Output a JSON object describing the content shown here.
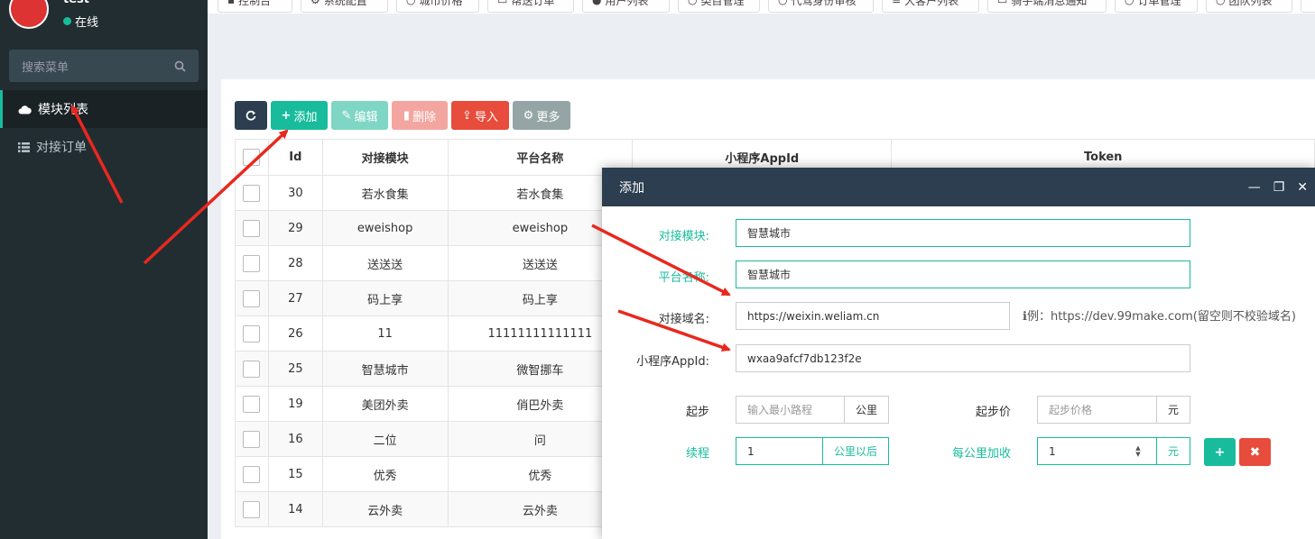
{
  "user": {
    "name": "test",
    "status": "在线"
  },
  "sidebar": {
    "search_placeholder": "搜索菜单",
    "items": [
      {
        "label": "模块列表",
        "icon": "cloud-icon"
      },
      {
        "label": "对接订单",
        "icon": "list-icon"
      }
    ]
  },
  "topnav": {
    "tabs": [
      "控制台",
      "系统配置",
      "城市价格",
      "帮送订单",
      "用户列表",
      "类目管理",
      "代驾身份审核",
      "大客户列表",
      "骑手端消息通知",
      "订单管理",
      "团队列表"
    ]
  },
  "toolbar": {
    "refresh_icon": "refresh-icon",
    "add_label": "添加",
    "edit_label": "编辑",
    "delete_label": "删除",
    "import_label": "导入",
    "more_label": "更多",
    "colors": {
      "dark": "#2c3e50",
      "add": "#18bc9c",
      "edit": "#7fd6c4",
      "delete": "#f3a69f",
      "import": "#e74c3c",
      "more": "#95a5a6"
    }
  },
  "table": {
    "headers": [
      "Id",
      "对接模块",
      "平台名称",
      "小程序AppId",
      "Token"
    ],
    "rows": [
      {
        "id": "30",
        "module": "若水食集",
        "platform": "若水食集"
      },
      {
        "id": "29",
        "module": "eweishop",
        "platform": "eweishop"
      },
      {
        "id": "28",
        "module": "送送送",
        "platform": "送送送"
      },
      {
        "id": "27",
        "module": "码上享",
        "platform": "码上享"
      },
      {
        "id": "26",
        "module": "11",
        "platform": "11111111111111"
      },
      {
        "id": "25",
        "module": "智慧城市",
        "platform": "微智挪车"
      },
      {
        "id": "19",
        "module": "美团外卖",
        "platform": "俏巴外卖"
      },
      {
        "id": "16",
        "module": "二位",
        "platform": "问"
      },
      {
        "id": "15",
        "module": "优秀",
        "platform": "优秀"
      },
      {
        "id": "14",
        "module": "云外卖",
        "platform": "云外卖"
      }
    ]
  },
  "modal": {
    "title": "添加",
    "fields": {
      "module_label": "对接模块:",
      "module_value": "智慧城市",
      "platform_label": "平台名称:",
      "platform_value": "智慧城市",
      "domain_label": "对接域名:",
      "domain_value": "https://weixin.weliam.cn",
      "domain_hint": "例：https://dev.99make.com(留空则不校验域名)",
      "appid_label": "小程序AppId:",
      "appid_value": "wxaa9afcf7db123f2e",
      "start_label": "起步",
      "start_placeholder": "输入最小路程",
      "start_unit": "公里",
      "start_price_label": "起步价",
      "start_price_placeholder": "起步价格",
      "start_price_unit": "元",
      "continue_label": "续程",
      "continue_value": "1",
      "continue_unit": "公里以后",
      "per_km_label": "每公里加收",
      "per_km_value": "1",
      "per_km_unit": "元"
    },
    "add_row_icon": "plus-icon",
    "remove_row_icon": "times-icon",
    "colors": {
      "header": "#2c3e50",
      "accent": "#18bc9c",
      "danger": "#e74c3c"
    }
  },
  "annotation_color": "#e8281e"
}
